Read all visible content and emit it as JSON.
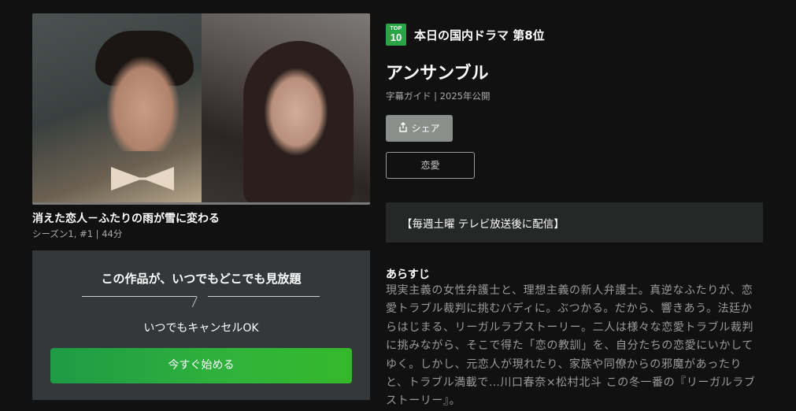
{
  "episode": {
    "title": "消えた恋人－ふたりの雨が雪に変わる",
    "meta": "シーズン1, #1 | 44分",
    "watch_progress": 1.0
  },
  "promo": {
    "headline": "この作品が、いつでもどこでも見放題",
    "subline": "いつでもキャンセルOK",
    "cta_label": "今すぐ始める"
  },
  "ranking": {
    "badge_top": "TOP",
    "badge_num": "10",
    "text": "本日の国内ドラマ 第8位"
  },
  "show": {
    "title": "アンサンブル",
    "meta": "字幕ガイド | 2025年公開",
    "share_label": "シェア",
    "genre_label": "恋愛"
  },
  "notice": "【毎週土曜 テレビ放送後に配信】",
  "synopsis": {
    "heading": "あらすじ",
    "body": "現実主義の女性弁護士と、理想主義の新人弁護士。真逆なふたりが、恋愛トラブル裁判に挑むバディに。ぶつかる。だから、響きあう。法廷からはじまる、リーガルラブストーリー。二人は様々な恋愛トラブル裁判に挑みながら、そこで得た「恋の教訓」を、自分たちの恋愛にいかしてゆく。しかし、元恋人が現れたり、家族や同僚からの邪魔があったりと、トラブル満載で…川口春奈×松村北斗 この冬一番の『リーガルラブストーリー』。"
  },
  "colors": {
    "background": "#111111",
    "promo_bg": "#35383a",
    "cta_green": "#2fb33b",
    "badge_green": "#29a547",
    "notice_bg": "#262828"
  }
}
